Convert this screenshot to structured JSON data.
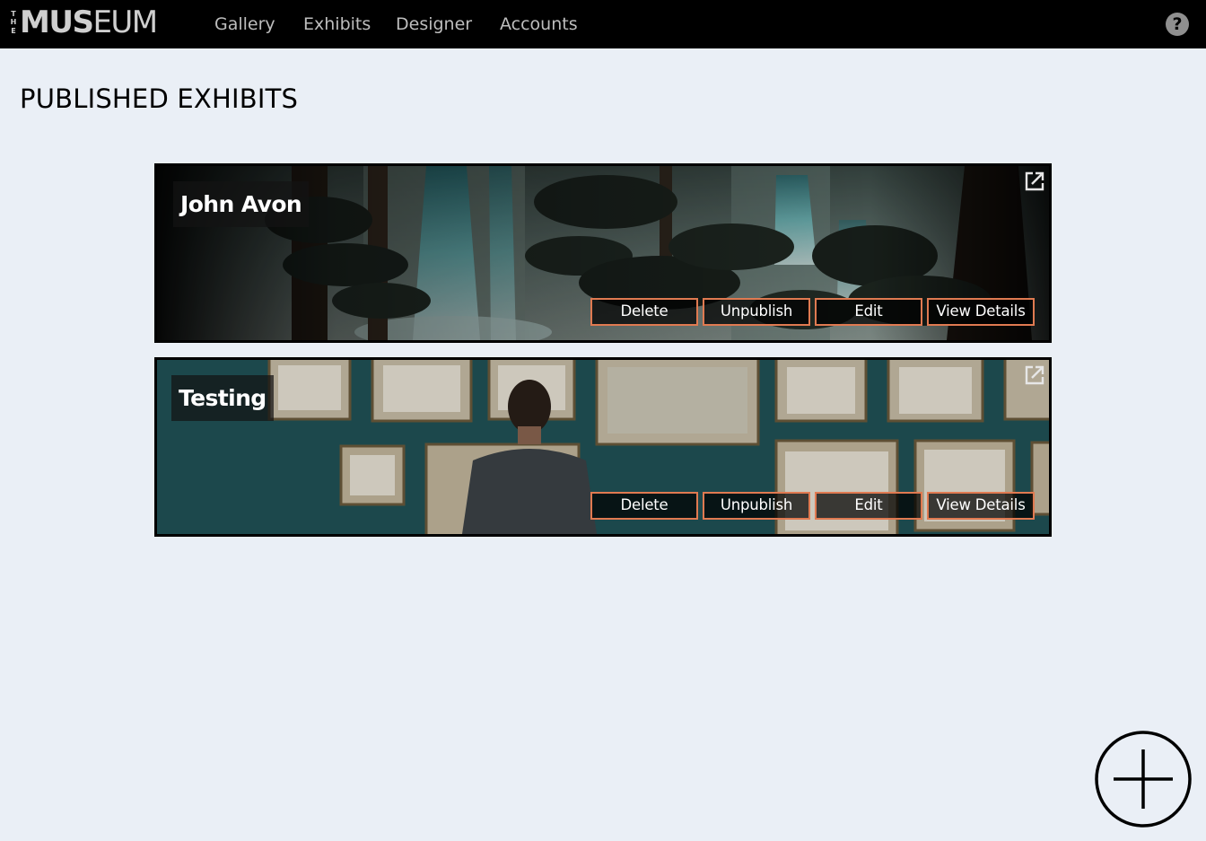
{
  "brand": {
    "the": [
      "T",
      "H",
      "E"
    ],
    "bold": "MUS",
    "light": "EUM"
  },
  "nav": {
    "items": [
      "Gallery",
      "Exhibits",
      "Designer",
      "Accounts"
    ],
    "help_icon": "question-circle-icon",
    "help_glyph": "?"
  },
  "page": {
    "title": "PUBLISHED EXHIBITS"
  },
  "exhibits": [
    {
      "title": "John Avon",
      "image": "forest-waterfall-painting",
      "open_icon": "open-external-icon",
      "buttons": [
        "Delete",
        "Unpublish",
        "Edit",
        "View Details"
      ]
    },
    {
      "title": "Testing",
      "image": "gallery-visitor-framed-art-photo",
      "open_icon": "open-external-icon",
      "buttons": [
        "Delete",
        "Unpublish",
        "Edit",
        "View Details"
      ]
    }
  ],
  "fab": {
    "icon": "plus-circle-icon"
  },
  "colors": {
    "background": "#eaeff6",
    "nav_background": "#000000",
    "nav_text": "#bdbdbd",
    "button_border": "#e07a51",
    "title_text": "#000000"
  }
}
